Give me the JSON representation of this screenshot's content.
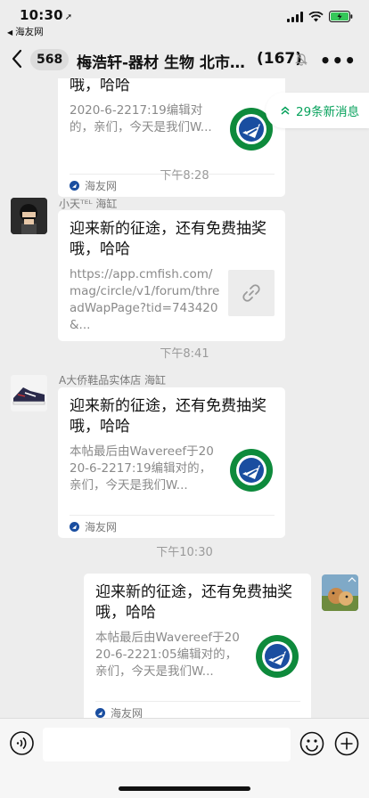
{
  "status": {
    "time": "10:30",
    "location_arrow": "➚",
    "back_app": "海友网"
  },
  "nav": {
    "unread_count": "568",
    "title": "梅浩轩-器材 生物 北市…",
    "member_count": "(167)"
  },
  "new_messages": "29条新消息",
  "messages": [
    {
      "title": "迎来新的征途，还有免费抽奖哦，哈哈",
      "desc": "2020-6-2217:19编辑对的，亲们，今天是我们W...",
      "source": "海友网"
    },
    {
      "time": "下午8:28",
      "sender": "小天ᵀᴱᴸ 海缸",
      "title": "迎来新的征途，还有免费抽奖哦，哈哈",
      "desc": "https://app.cmfish.com/mag/circle/v1/forum/threadWapPage?tid=743420&..."
    },
    {
      "time": "下午8:41",
      "sender": "A大侨鞋品实体店 海缸",
      "title": "迎来新的征途，还有免费抽奖哦，哈哈",
      "desc": "本帖最后由Wavereef于2020-6-2217:19编辑对的，亲们，今天是我们W...",
      "source": "海友网"
    },
    {
      "time": "下午10:30",
      "title": "迎来新的征途，还有免费抽奖哦，哈哈",
      "desc": "本帖最后由Wavereef于2020-6-2221:05编辑对的，亲们，今天是我们W...",
      "source": "海友网"
    }
  ],
  "colors": {
    "background": "#ededed",
    "accent_green": "#07a25c",
    "logo_green": "#0e8a3c",
    "logo_blue": "#1a4ea0"
  },
  "icons": {
    "back": "chevron-left-icon",
    "mute": "bell-off-icon",
    "more": "more-icon",
    "new_msg": "double-chevron-up-icon",
    "link": "link-icon",
    "voice": "voice-icon",
    "emoji": "emoji-icon",
    "plus": "plus-icon"
  }
}
